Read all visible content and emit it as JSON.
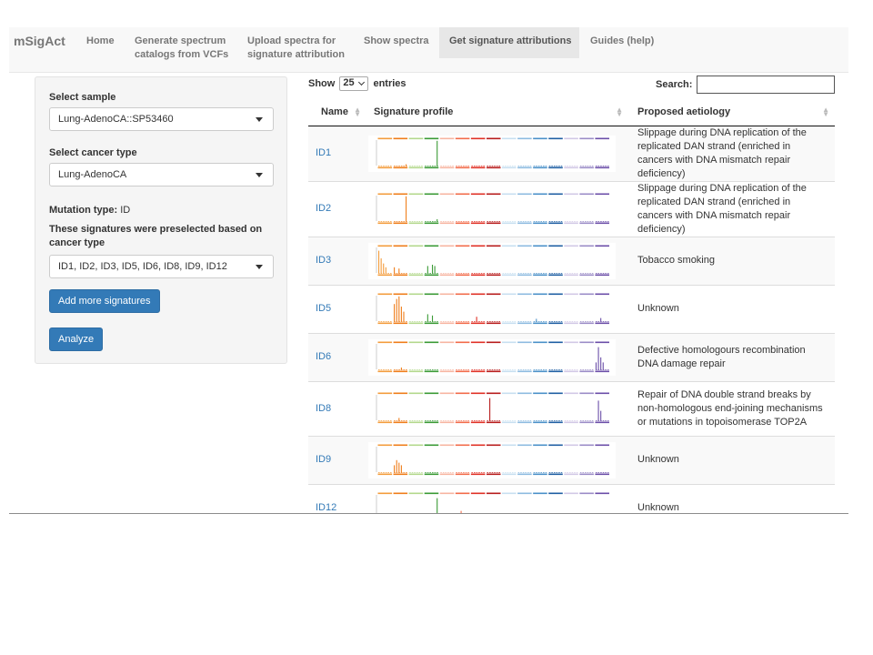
{
  "app": {
    "brand": "mSigAct",
    "nav": [
      {
        "lines": [
          "Home"
        ],
        "active": false
      },
      {
        "lines": [
          "Generate spectrum",
          "catalogs from VCFs"
        ],
        "active": false
      },
      {
        "lines": [
          "Upload spectra for",
          "signature attribution"
        ],
        "active": false
      },
      {
        "lines": [
          "Show spectra"
        ],
        "active": false
      },
      {
        "lines": [
          "Get signature attributions"
        ],
        "active": true
      },
      {
        "lines": [
          "Guides (help)"
        ],
        "active": false
      }
    ]
  },
  "sidebar": {
    "sample_label": "Select sample",
    "sample_value": "Lung-AdenoCA::SP53460",
    "cancer_label": "Select cancer type",
    "cancer_value": "Lung-AdenoCA",
    "mutation_type_label": "Mutation type:",
    "mutation_type_value": "ID",
    "preselected_label": "These signatures were preselected based on cancer type",
    "preselected_value": "ID1, ID2, ID3, ID5, ID6, ID8, ID9, ID12",
    "add_button": "Add more signatures",
    "analyze_button": "Analyze"
  },
  "table": {
    "show_label": "Show",
    "page_length": "25",
    "entries_label": "entries",
    "search_label": "Search:",
    "columns": [
      "Name",
      "Signature profile",
      "Proposed aetiology"
    ],
    "rows": [
      {
        "name": "ID1",
        "aetiology": "Slippage during DNA replication of the replicated DAN strand (enriched in cancers with DNA mismatch repair deficiency)"
      },
      {
        "name": "ID2",
        "aetiology": "Slippage during DNA replication of the replicated DAN strand (enriched in cancers with DNA mismatch repair deficiency)"
      },
      {
        "name": "ID3",
        "aetiology": "Tobacco smoking"
      },
      {
        "name": "ID5",
        "aetiology": "Unknown"
      },
      {
        "name": "ID6",
        "aetiology": "Defective homologours recombination DNA damage repair"
      },
      {
        "name": "ID8",
        "aetiology": "Repair of DNA double strand breaks by non-homologous end-joining mechanisms or mutations in topoisomerase TOP2A"
      },
      {
        "name": "ID9",
        "aetiology": "Unknown"
      },
      {
        "name": "ID12",
        "aetiology": "Unknown"
      }
    ]
  },
  "colors": {
    "primary": "#337ab7",
    "profile_groups": [
      "#f39c3c",
      "#ef7d1a",
      "#b3d88c",
      "#3a9a35",
      "#f7b5a1",
      "#f26b4a",
      "#e03126",
      "#b71c1c",
      "#c7dff0",
      "#8dbbe0",
      "#4a90c8",
      "#1f5fa3",
      "#d2c8e6",
      "#9b8cc7",
      "#6b4ea8"
    ]
  },
  "profiles": {
    "ID1": [
      {
        "g": 3,
        "p": 5,
        "v": 1.0
      },
      {
        "g": 1,
        "p": 5,
        "v": 0.08
      }
    ],
    "ID2": [
      {
        "g": 1,
        "p": 5,
        "v": 1.0
      },
      {
        "g": 3,
        "p": 5,
        "v": 0.1
      }
    ],
    "ID3": [
      {
        "g": 0,
        "p": 0,
        "v": 0.9
      },
      {
        "g": 0,
        "p": 1,
        "v": 0.6
      },
      {
        "g": 0,
        "p": 2,
        "v": 0.4
      },
      {
        "g": 0,
        "p": 3,
        "v": 0.25
      },
      {
        "g": 1,
        "p": 0,
        "v": 0.25
      },
      {
        "g": 1,
        "p": 2,
        "v": 0.2
      },
      {
        "g": 3,
        "p": 1,
        "v": 0.3
      },
      {
        "g": 3,
        "p": 3,
        "v": 0.35
      },
      {
        "g": 3,
        "p": 4,
        "v": 0.3
      }
    ],
    "ID5": [
      {
        "g": 1,
        "p": 0,
        "v": 0.7
      },
      {
        "g": 1,
        "p": 1,
        "v": 0.9
      },
      {
        "g": 1,
        "p": 2,
        "v": 1.0
      },
      {
        "g": 1,
        "p": 3,
        "v": 0.6
      },
      {
        "g": 1,
        "p": 4,
        "v": 0.4
      },
      {
        "g": 3,
        "p": 1,
        "v": 0.3
      },
      {
        "g": 3,
        "p": 3,
        "v": 0.25
      },
      {
        "g": 6,
        "p": 2,
        "v": 0.2
      },
      {
        "g": 10,
        "p": 1,
        "v": 0.12
      },
      {
        "g": 14,
        "p": 2,
        "v": 0.15
      }
    ],
    "ID6": [
      {
        "g": 14,
        "p": 0,
        "v": 0.3
      },
      {
        "g": 14,
        "p": 1,
        "v": 0.9
      },
      {
        "g": 14,
        "p": 2,
        "v": 0.5
      },
      {
        "g": 14,
        "p": 3,
        "v": 0.3
      },
      {
        "g": 1,
        "p": 3,
        "v": 0.1
      }
    ],
    "ID8": [
      {
        "g": 7,
        "p": 1,
        "v": 0.9
      },
      {
        "g": 14,
        "p": 1,
        "v": 0.8
      },
      {
        "g": 14,
        "p": 2,
        "v": 0.4
      },
      {
        "g": 1,
        "p": 2,
        "v": 0.12
      }
    ],
    "ID9": [
      {
        "g": 1,
        "p": 0,
        "v": 0.3
      },
      {
        "g": 1,
        "p": 1,
        "v": 0.5
      },
      {
        "g": 1,
        "p": 2,
        "v": 0.4
      },
      {
        "g": 1,
        "p": 3,
        "v": 0.3
      }
    ],
    "ID12": [
      {
        "g": 3,
        "p": 5,
        "v": 0.9
      },
      {
        "g": 1,
        "p": 2,
        "v": 0.3
      },
      {
        "g": 5,
        "p": 2,
        "v": 0.4
      }
    ]
  }
}
